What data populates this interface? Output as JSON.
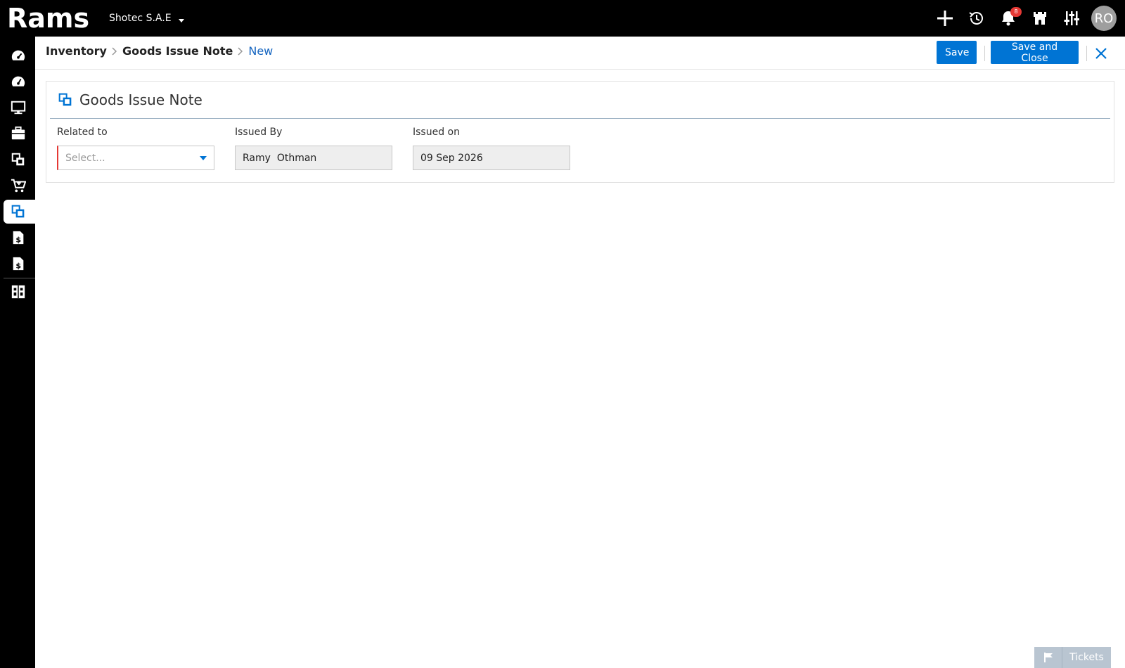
{
  "app": {
    "logo_text": "Rams",
    "company": "Shotec S.A.E"
  },
  "topbar": {
    "notifications_count": "8",
    "avatar_initials": "RO",
    "icons": [
      "add-icon",
      "history-icon",
      "bell-icon",
      "castle-icon",
      "sliders-icon"
    ]
  },
  "sidebar": {
    "items": [
      {
        "icon": "dashboard-icon"
      },
      {
        "icon": "dashboard-alt-icon"
      },
      {
        "icon": "monitor-icon"
      },
      {
        "icon": "briefcase-icon"
      },
      {
        "icon": "inventory-icon"
      },
      {
        "icon": "cart-icon"
      },
      {
        "icon": "goods-issue-icon",
        "active": true
      },
      {
        "icon": "invoice-icon"
      },
      {
        "icon": "invoice-alt-icon"
      },
      {
        "icon": "reports-icon"
      }
    ]
  },
  "breadcrumb": {
    "items": [
      "Inventory",
      "Goods Issue Note",
      "New"
    ]
  },
  "actions": {
    "save_label": "Save",
    "save_close_label": "Save and Close"
  },
  "form": {
    "title": "Goods Issue Note",
    "related_to": {
      "label": "Related to",
      "placeholder": "Select..."
    },
    "issued_by": {
      "label": "Issued By",
      "value": "Ramy  Othman"
    },
    "issued_on": {
      "label": "Issued on",
      "value": "09 Sep 2026"
    }
  },
  "tickets": {
    "label": "Tickets"
  },
  "colors": {
    "primary": "#0074d4",
    "topbar": "#000000",
    "required": "#e53935",
    "badge": "#e53935"
  }
}
